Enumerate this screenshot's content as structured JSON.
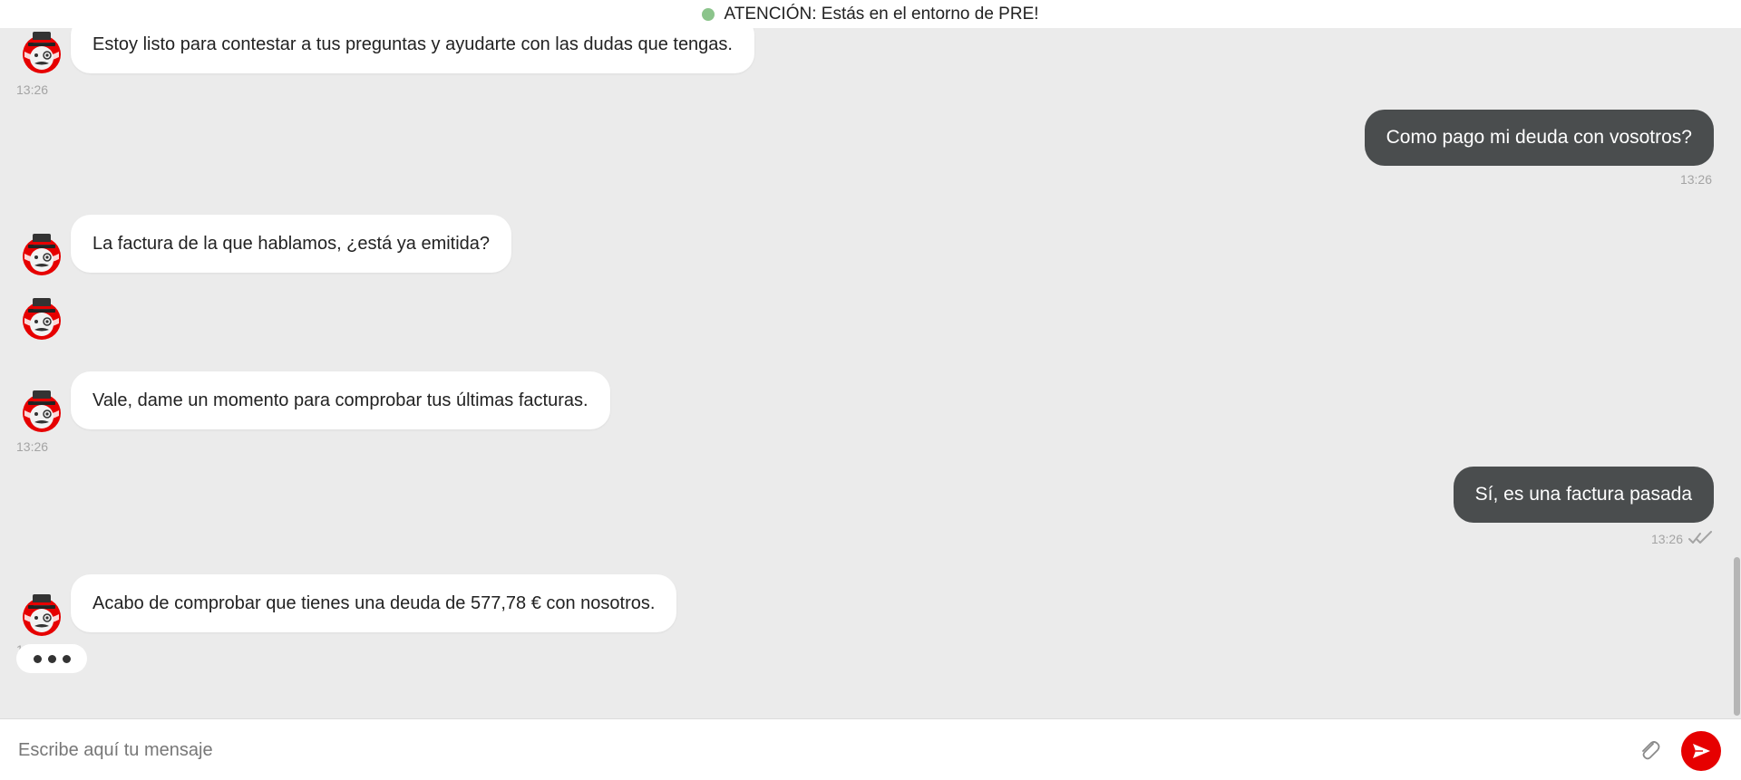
{
  "banner": {
    "text": "ATENCIÓN: Estás en el entorno de PRE!",
    "dot_color": "#8bc48b"
  },
  "messages": {
    "m1": {
      "text": "Estoy listo para contestar a tus preguntas y ayudarte con las dudas que tengas.",
      "time": "13:26"
    },
    "m2": {
      "text": "Como pago mi deuda con vosotros?",
      "time": "13:26"
    },
    "m3": {
      "text": "La factura de la que hablamos, ¿está ya emitida?"
    },
    "m4": {
      "text": "Vale, dame un momento para comprobar tus últimas facturas.",
      "time": "13:26"
    },
    "m5": {
      "text": "Sí, es una factura pasada",
      "time": "13:26"
    },
    "m6": {
      "text": "Acabo de comprobar que tienes una deuda de 577,78 € con nosotros.",
      "time": "13:26"
    }
  },
  "icons": {
    "bot_avatar": "bot-avatar-icon",
    "read_receipt": "double-check-icon",
    "attach": "paperclip-icon",
    "send": "send-arrow-icon"
  },
  "composer": {
    "placeholder": "Escribe aquí tu mensaje"
  },
  "colors": {
    "background": "#ebebeb",
    "bot_bubble": "#ffffff",
    "user_bubble": "#4a4d4e",
    "accent": "#e60000",
    "timestamp": "#a4a4a4"
  }
}
